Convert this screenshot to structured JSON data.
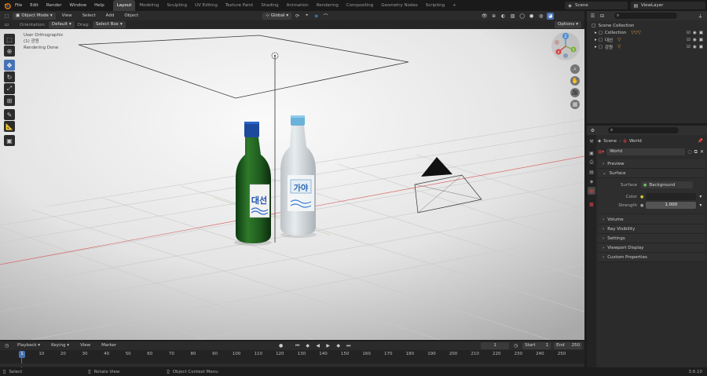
{
  "menu": {
    "file": "File",
    "edit": "Edit",
    "render": "Render",
    "window": "Window",
    "help": "Help"
  },
  "workspaces": [
    "Layout",
    "Modeling",
    "Sculpting",
    "UV Editing",
    "Texture Paint",
    "Shading",
    "Animation",
    "Rendering",
    "Compositing",
    "Geometry Nodes",
    "Scripting"
  ],
  "workspace_add": "+",
  "scene_name": "Scene",
  "view_layer": "ViewLayer",
  "viewport_header": {
    "mode": "Object Mode",
    "view": "View",
    "select": "Select",
    "add": "Add",
    "object": "Object",
    "transform": "Global"
  },
  "tool_settings": {
    "orientation_label": "Orientation:",
    "orientation_value": "Default",
    "drag_label": "Drag:",
    "drag_value": "Select Box",
    "options": "Options"
  },
  "viewport_info": {
    "line1": "User Orthographic",
    "line2": "(1) 광원",
    "line3": "Rendering Done"
  },
  "gizmo": {
    "z": "Z",
    "y": "Y",
    "x": "X"
  },
  "bottle_left": {
    "label": "대선"
  },
  "bottle_right": {
    "label": "가야"
  },
  "outliner": {
    "scene_collection": "Scene Collection",
    "items": [
      {
        "name": "Collection"
      },
      {
        "name": "대선"
      },
      {
        "name": "강원"
      }
    ]
  },
  "properties": {
    "breadcrumb_scene": "Scene",
    "breadcrumb_world": "World",
    "world_name": "World",
    "panels": {
      "preview": "Preview",
      "surface": "Surface",
      "volume": "Volume",
      "ray_visibility": "Ray Visibility",
      "settings": "Settings",
      "viewport_display": "Viewport Display",
      "custom_properties": "Custom Properties"
    },
    "surface_label": "Surface",
    "surface_value": "Background",
    "color_label": "Color",
    "strength_label": "Strength",
    "strength_value": "1.000"
  },
  "timeline": {
    "playback": "Playback",
    "keying": "Keying",
    "view": "View",
    "marker": "Marker",
    "current_frame": "1",
    "start_label": "Start",
    "start_value": "1",
    "end_label": "End",
    "end_value": "250",
    "playhead": "1",
    "ticks": [
      "1",
      "10",
      "20",
      "30",
      "40",
      "50",
      "60",
      "70",
      "80",
      "90",
      "100",
      "110",
      "120",
      "130",
      "140",
      "150",
      "160",
      "170",
      "180",
      "190",
      "200",
      "210",
      "220",
      "230",
      "240",
      "250"
    ]
  },
  "statusbar": {
    "select": "Select",
    "rotate": "Rotate View",
    "context": "Object Context Menu",
    "version": "3.6.10"
  },
  "colors": {
    "accent": "#4772b3",
    "header": "#2b2b2b",
    "viewport_bg": "#f0f0f0",
    "x_axis": "#d04040",
    "y_axis": "#7ab03a",
    "z_axis": "#4c8bd6"
  }
}
